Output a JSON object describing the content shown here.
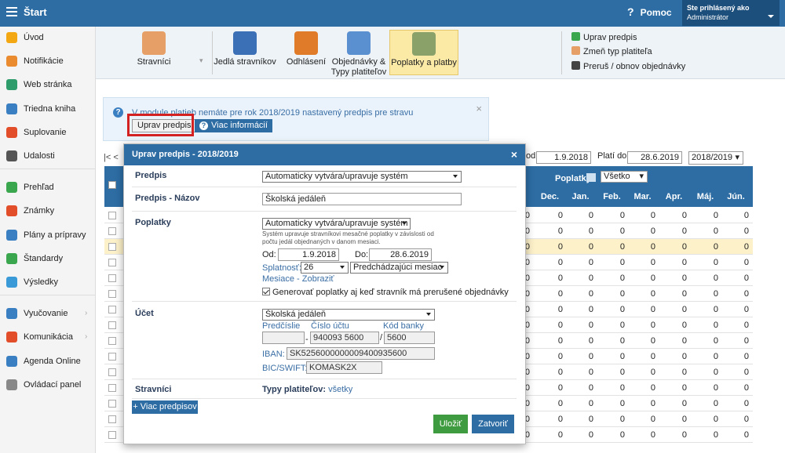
{
  "header": {
    "title": "Štart",
    "help": "Pomoc",
    "user_prefix": "Ste prihlásený ako",
    "user_name": "Administrátor"
  },
  "sidebar": {
    "items": [
      {
        "label": "Úvod",
        "icon": "star-icon",
        "color": "#f3a712"
      },
      {
        "label": "Notifikácie",
        "icon": "envelope-icon",
        "color": "#e98b2e"
      },
      {
        "label": "Web stránka",
        "icon": "home-icon",
        "color": "#2f9c6c"
      },
      {
        "label": "Triedna kniha",
        "icon": "book-icon",
        "color": "#3a7fc1"
      },
      {
        "label": "Suplovanie",
        "icon": "person-icon",
        "color": "#e24e2a"
      },
      {
        "label": "Udalosti",
        "icon": "calendar-icon",
        "color": "#555555"
      },
      {
        "label": "Prehľad",
        "icon": "check-circle-icon",
        "color": "#3aa64d"
      },
      {
        "label": "Známky",
        "icon": "grade-icon",
        "color": "#e24e2a"
      },
      {
        "label": "Plány a prípravy",
        "icon": "briefcase-icon",
        "color": "#3a7fc1"
      },
      {
        "label": "Štandardy",
        "icon": "shield-icon",
        "color": "#3aa64d"
      },
      {
        "label": "Výsledky",
        "icon": "bar-chart-icon",
        "color": "#3a9ad8"
      },
      {
        "label": "Vyučovanie",
        "icon": "open-book-icon",
        "color": "#3a7fc1"
      },
      {
        "label": "Komunikácia",
        "icon": "chat-icon",
        "color": "#e24e2a"
      },
      {
        "label": "Agenda Online",
        "icon": "pen-icon",
        "color": "#3a7fc1"
      },
      {
        "label": "Ovládací panel",
        "icon": "gear-icon",
        "color": "#888888"
      }
    ]
  },
  "ribbon": {
    "buttons": [
      {
        "label": "Stravníci",
        "icon": "diners-icon",
        "color": "#e6a067"
      },
      {
        "label": "Jedlá stravníkov",
        "icon": "meal-icon",
        "color": "#3b6fb6"
      },
      {
        "label": "Odhlásení",
        "icon": "logout-meal-icon",
        "color": "#e07b2a"
      },
      {
        "label": "Objednávky &",
        "label2": "Typy platiteľov",
        "icon": "orders-icon",
        "color": "#5a8fd0"
      },
      {
        "label": "Poplatky a platby",
        "icon": "payments-icon",
        "color": "#8aa26a"
      }
    ],
    "links": [
      {
        "label": "Uprav predpis",
        "icon": "edit-icon",
        "color": "#3aa64d"
      },
      {
        "label": "Zmeň typ platiteľa",
        "icon": "user-change-icon",
        "color": "#e6a067"
      },
      {
        "label": "Preruš / obnov objednávky",
        "icon": "traffic-light-icon",
        "color": "#444444"
      }
    ]
  },
  "alert": {
    "message": "V module platieb nemáte pre rok 2018/2019 nastavený predpis pre stravu",
    "button": "Uprav predpis",
    "info_button": "Viac informácií",
    "close": "×"
  },
  "toolbar": {
    "pager": "|< <",
    "od_label": "od:",
    "od_value": "1.9.2018",
    "plati_label": "Platí do:",
    "plati_value": "28.6.2019",
    "year": "2018/2019"
  },
  "table": {
    "poplatky_label": "Poplatky",
    "filter": "Všetko",
    "months": [
      "Dec.",
      "Jan.",
      "Feb.",
      "Mar.",
      "Apr.",
      "Máj.",
      "Jún."
    ],
    "rows": [
      {
        "values": [
          "0",
          "0",
          "0",
          "0",
          "0",
          "0",
          "0",
          "0"
        ],
        "highlight": false
      },
      {
        "values": [
          "0",
          "0",
          "0",
          "0",
          "0",
          "0",
          "0",
          "0"
        ],
        "highlight": false
      },
      {
        "values": [
          "0",
          "0",
          "0",
          "0",
          "0",
          "0",
          "0",
          "0"
        ],
        "highlight": true
      },
      {
        "values": [
          "0",
          "0",
          "0",
          "0",
          "0",
          "0",
          "0",
          "0"
        ],
        "highlight": false
      },
      {
        "values": [
          "0",
          "0",
          "0",
          "0",
          "0",
          "0",
          "0",
          "0"
        ],
        "highlight": false
      },
      {
        "values": [
          "0",
          "0",
          "0",
          "0",
          "0",
          "0",
          "0",
          "0"
        ],
        "highlight": false
      },
      {
        "values": [
          "0",
          "0",
          "0",
          "0",
          "0",
          "0",
          "0",
          "0"
        ],
        "highlight": false
      },
      {
        "values": [
          "0",
          "0",
          "0",
          "0",
          "0",
          "0",
          "0",
          "0"
        ],
        "highlight": false
      },
      {
        "values": [
          "0",
          "0",
          "0",
          "0",
          "0",
          "0",
          "0",
          "0"
        ],
        "highlight": false
      },
      {
        "values": [
          "0",
          "0",
          "0",
          "0",
          "0",
          "0",
          "0",
          "0"
        ],
        "highlight": false
      },
      {
        "values": [
          "0",
          "0",
          "0",
          "0",
          "0",
          "0",
          "0",
          "0"
        ],
        "highlight": false
      },
      {
        "values": [
          "0",
          "0",
          "0",
          "0",
          "0",
          "0",
          "0",
          "0"
        ],
        "highlight": false
      },
      {
        "values": [
          "0",
          "0",
          "0",
          "0",
          "0",
          "0",
          "0",
          "0"
        ],
        "highlight": false
      },
      {
        "values": [
          "0",
          "0",
          "0",
          "0",
          "0",
          "0",
          "0",
          "0"
        ],
        "highlight": false
      },
      {
        "values": [
          "0",
          "0",
          "0",
          "0",
          "0",
          "0",
          "0",
          "0"
        ],
        "highlight": false
      }
    ]
  },
  "modal": {
    "title": "Uprav predpis - 2018/2019",
    "close": "×",
    "predpis_label": "Predpis",
    "predpis_value": "Automaticky vytvára/upravuje systém",
    "nazov_label": "Predpis - Názov",
    "nazov_value": "Školská jedáleň",
    "poplatky_label": "Poplatky",
    "poplatky_value": "Automaticky vytvára/upravuje systém",
    "poplatky_help1": "Systém upravuje stravníkovi mesačné poplatky v závislosti od",
    "poplatky_help2": "počtu jedál objednaných v danom mesiaci.",
    "od_label": "Od:",
    "od_value": "1.9.2018",
    "do_label": "Do:",
    "do_value": "28.6.2019",
    "splatnost_label": "Splatnosť:",
    "splatnost_value": "26",
    "splatnost_period": "Predchádzajúci mesiac",
    "mesiace_link": "Mesiace - Zobraziť",
    "generovat_label": "Generovať poplatky aj keď stravník má prerušené objednávky",
    "ucet_label": "Účet",
    "ucet_value": "Školská jedáleň",
    "predcislie_label": "Predčíslie",
    "cislo_label": "Číslo účtu",
    "kod_label": "Kód banky",
    "predcislie_value": "",
    "cislo_value": "940093 5600",
    "kod_value": "5600",
    "iban_label": "IBAN:",
    "iban_value": "SK5256000000009400935600",
    "bic_label": "BIC/SWIFT:",
    "bic_value": "KOMASK2X",
    "stravnici_label": "Stravníci",
    "typy_label": "Typy platiteľov:",
    "typy_value": "všetky",
    "more_button": "+ Viac predpisov",
    "save_button": "Uložiť",
    "close_button": "Zatvoriť"
  }
}
